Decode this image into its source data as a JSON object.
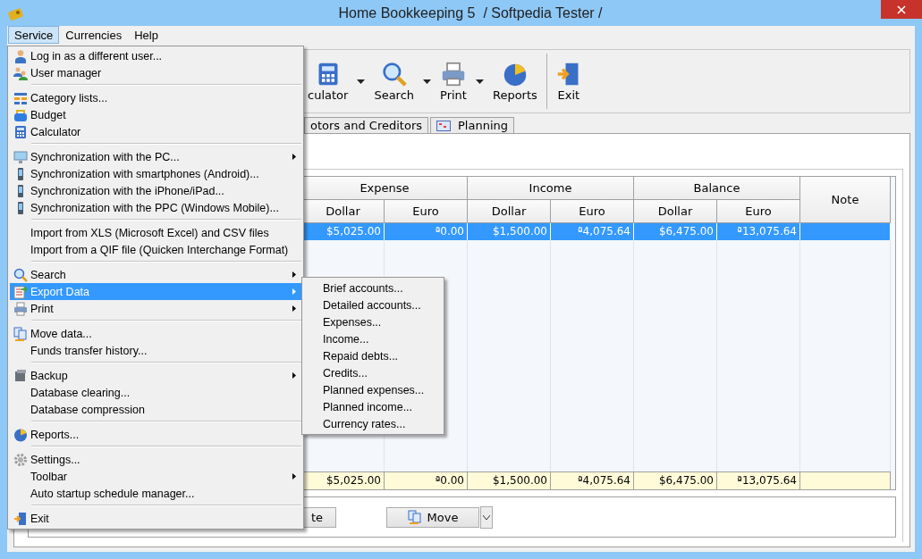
{
  "window": {
    "title": "Home Bookkeeping 5  / Softpedia Tester /"
  },
  "menubar": [
    {
      "label": "Service",
      "selected": true
    },
    {
      "label": "Currencies",
      "selected": false
    },
    {
      "label": "Help",
      "selected": false
    }
  ],
  "menu": {
    "items": [
      {
        "kind": "item",
        "label": "Log in as a different user...",
        "has_submenu": false,
        "selected": false
      },
      {
        "kind": "item",
        "label": "User manager",
        "has_submenu": false,
        "selected": false
      },
      {
        "kind": "separator"
      },
      {
        "kind": "item",
        "label": "Category lists...",
        "has_submenu": false,
        "selected": false
      },
      {
        "kind": "item",
        "label": "Budget",
        "has_submenu": false,
        "selected": false
      },
      {
        "kind": "item",
        "label": "Calculator",
        "has_submenu": false,
        "selected": false
      },
      {
        "kind": "separator"
      },
      {
        "kind": "item",
        "label": "Synchronization with the PC...",
        "has_submenu": true,
        "selected": false
      },
      {
        "kind": "item",
        "label": "Synchronization with smartphones (Android)...",
        "has_submenu": false,
        "selected": false
      },
      {
        "kind": "item",
        "label": "Synchronization with the iPhone/iPad...",
        "has_submenu": false,
        "selected": false
      },
      {
        "kind": "item",
        "label": "Synchronization with the PPC (Windows Mobile)...",
        "has_submenu": false,
        "selected": false
      },
      {
        "kind": "separator"
      },
      {
        "kind": "item",
        "label": "Import from XLS (Microsoft Excel) and CSV files",
        "has_submenu": false,
        "selected": false
      },
      {
        "kind": "item",
        "label": "Import from a QIF file (Quicken Interchange Format)",
        "has_submenu": false,
        "selected": false
      },
      {
        "kind": "separator"
      },
      {
        "kind": "item",
        "label": "Search",
        "has_submenu": true,
        "selected": false
      },
      {
        "kind": "item",
        "label": "Export Data",
        "has_submenu": true,
        "selected": true
      },
      {
        "kind": "item",
        "label": "Print",
        "has_submenu": true,
        "selected": false
      },
      {
        "kind": "separator"
      },
      {
        "kind": "item",
        "label": "Move data...",
        "has_submenu": false,
        "selected": false
      },
      {
        "kind": "item",
        "label": "Funds transfer history...",
        "has_submenu": false,
        "selected": false
      },
      {
        "kind": "separator"
      },
      {
        "kind": "item",
        "label": "Backup",
        "has_submenu": true,
        "selected": false
      },
      {
        "kind": "item",
        "label": "Database clearing...",
        "has_submenu": false,
        "selected": false
      },
      {
        "kind": "item",
        "label": "Database compression",
        "has_submenu": false,
        "selected": false
      },
      {
        "kind": "separator"
      },
      {
        "kind": "item",
        "label": "Reports...",
        "has_submenu": false,
        "selected": false
      },
      {
        "kind": "separator"
      },
      {
        "kind": "item",
        "label": "Settings...",
        "has_submenu": false,
        "selected": false
      },
      {
        "kind": "item",
        "label": "Toolbar",
        "has_submenu": true,
        "selected": false
      },
      {
        "kind": "item",
        "label": "Auto startup schedule manager...",
        "has_submenu": false,
        "selected": false
      },
      {
        "kind": "separator"
      },
      {
        "kind": "item",
        "label": "Exit",
        "has_submenu": false,
        "selected": false
      }
    ]
  },
  "submenu": {
    "items": [
      "Brief accounts...",
      "Detailed accounts...",
      "Expenses...",
      "Income...",
      "Repaid debts...",
      "Credits...",
      "Planned expenses...",
      "Planned income...",
      "Currency rates..."
    ]
  },
  "toolbar": {
    "items": [
      {
        "label": "culator",
        "dropdown": true
      },
      {
        "label": "Search",
        "dropdown": true
      },
      {
        "label": "Print",
        "dropdown": true
      },
      {
        "label": "Reports",
        "dropdown": false
      },
      {
        "label": "Exit",
        "dropdown": false
      }
    ]
  },
  "tabs": [
    {
      "label": "otors and Creditors",
      "selected": false
    },
    {
      "label": "Planning",
      "selected": false
    }
  ],
  "table": {
    "groups": [
      {
        "label": "Expense",
        "columns": [
          "Dollar",
          "Euro"
        ]
      },
      {
        "label": "Income",
        "columns": [
          "Dollar",
          "Euro"
        ]
      },
      {
        "label": "Balance",
        "columns": [
          "Dollar",
          "Euro"
        ]
      }
    ],
    "note_column": "Note",
    "rows": [
      {
        "cells": [
          "$5,025.00",
          "ª0.00",
          "$1,500.00",
          "ª4,075.64",
          "$6,475.00",
          "ª13,075.64"
        ],
        "selected": true
      }
    ],
    "totals": [
      "$5,025.00",
      "ª0.00",
      "$1,500.00",
      "ª4,075.64",
      "$6,475.00",
      "ª13,075.64"
    ]
  },
  "buttons": [
    {
      "label": "te",
      "dropdown": false
    },
    {
      "label": "Move",
      "dropdown": true
    }
  ]
}
